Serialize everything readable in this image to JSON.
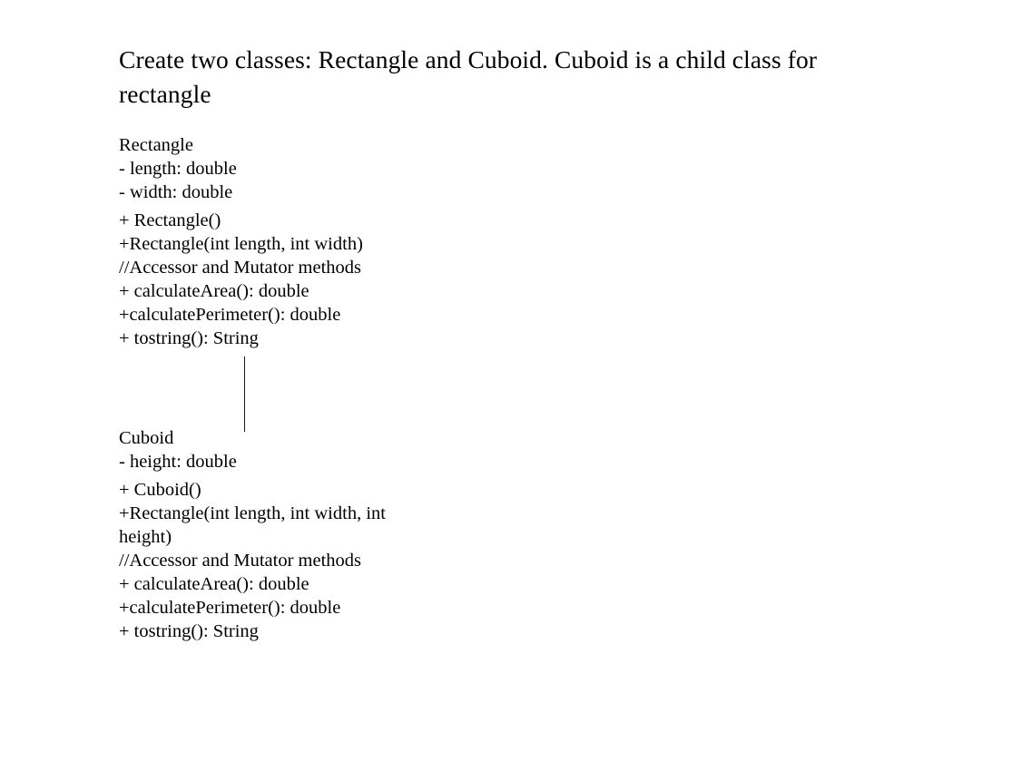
{
  "document": {
    "title": "Create two classes: Rectangle and Cuboid. Cuboid is a child class for rectangle"
  },
  "diagram": {
    "connector_label": "",
    "line_color": "#1a1a1a",
    "classes": [
      {
        "name": "Rectangle",
        "attributes": [
          "- length: double",
          "- width: double"
        ],
        "members": [
          "+ Rectangle()",
          "+Rectangle(int length, int width)",
          "//Accessor and Mutator methods",
          "+ calculateArea(): double",
          "+calculatePerimeter(): double",
          "+ tostring(): String"
        ]
      },
      {
        "name": "Cuboid",
        "attributes": [
          "- height: double"
        ],
        "members": [
          "+ Cuboid()",
          "+Rectangle(int length, int width, int height)",
          "//Accessor and Mutator methods",
          "+ calculateArea(): double",
          "+calculatePerimeter(): double",
          "+ tostring(): String"
        ]
      }
    ]
  }
}
